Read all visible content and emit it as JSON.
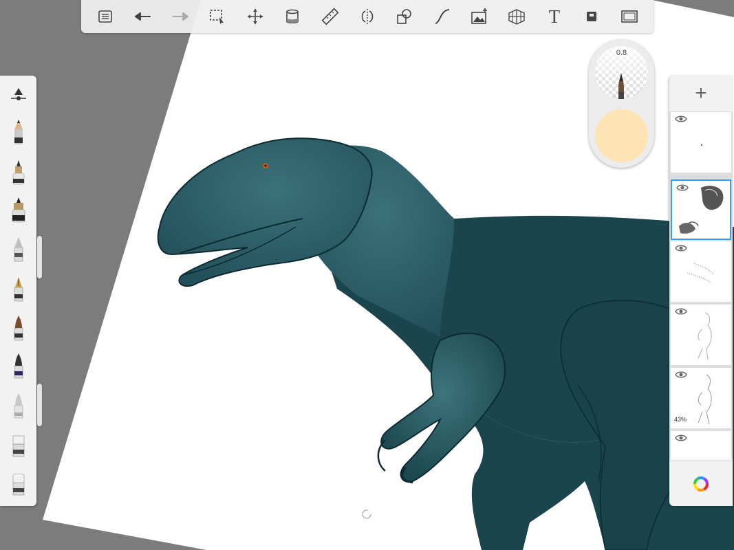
{
  "toolbar": {
    "items": [
      "list-icon",
      "undo-icon",
      "redo-icon",
      "selection-icon",
      "transform-icon",
      "fill-icon",
      "ruler-icon",
      "symmetry-icon",
      "shape-icon",
      "curve-icon",
      "image-icon",
      "perspective-icon",
      "text-icon",
      "layer-icon",
      "fullscreen-icon"
    ],
    "text_label": "T"
  },
  "brushes": [
    "pencil",
    "pen-marker",
    "inking-pen",
    "ballpoint",
    "fineliner",
    "paintbrush",
    "airbrush",
    "smudge",
    "eraser-hard",
    "eraser-soft"
  ],
  "puck": {
    "brush_size": "0.8",
    "current_color": "#fee4b4"
  },
  "layers": {
    "add_label": "+",
    "items": [
      {
        "name": "layer-dot",
        "selected": false,
        "opacity": ""
      },
      {
        "name": "layer-dino-reference",
        "selected": true,
        "opacity": ""
      },
      {
        "name": "layer-marks",
        "selected": false,
        "opacity": ""
      },
      {
        "name": "layer-sketch-1",
        "selected": false,
        "opacity": ""
      },
      {
        "name": "layer-sketch-2",
        "selected": false,
        "opacity": "43%"
      },
      {
        "name": "layer-empty",
        "selected": false,
        "opacity": ""
      }
    ]
  },
  "colors": {
    "accent": "#3d9be9",
    "dino_body": "#1a444b",
    "dino_head": "#2b5c64",
    "canvas_bg": "#7c7c7c"
  }
}
